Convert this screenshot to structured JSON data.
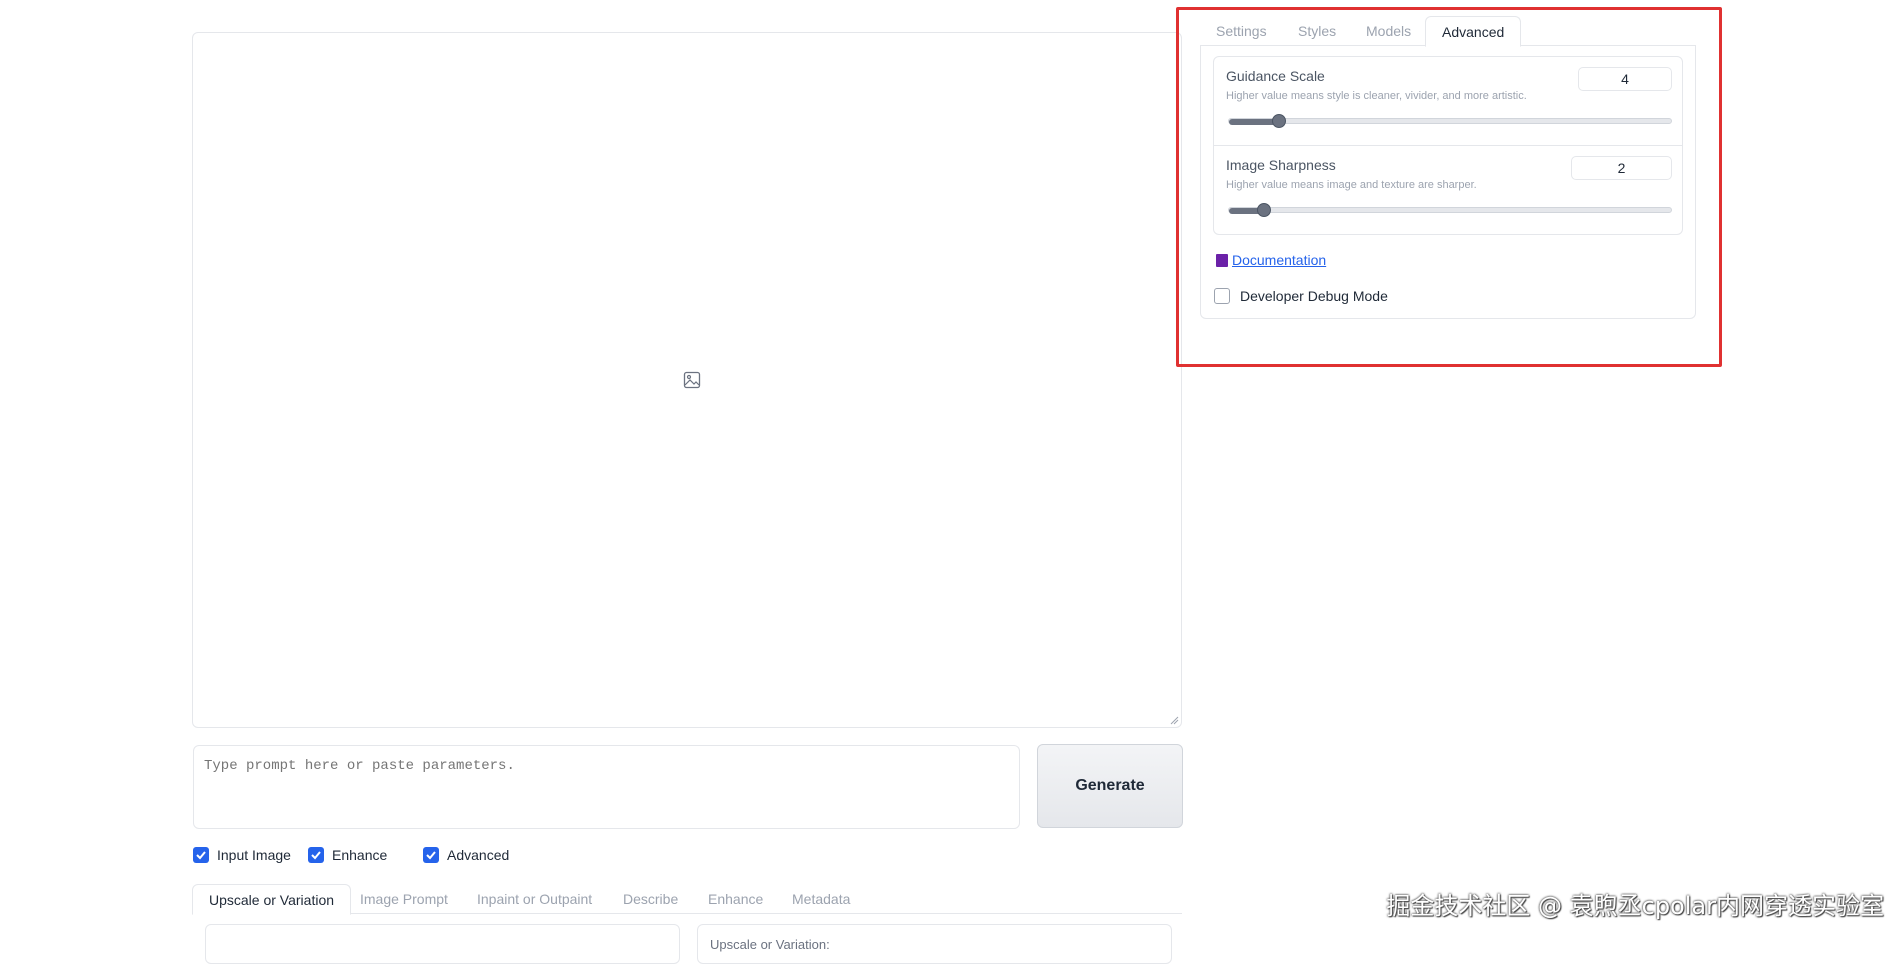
{
  "image_area": {
    "icon": "image-placeholder-icon"
  },
  "prompt": {
    "placeholder": "Type prompt here or paste parameters."
  },
  "generate": {
    "label": "Generate"
  },
  "options": [
    {
      "label": "Input Image",
      "checked": true
    },
    {
      "label": "Enhance",
      "checked": true
    },
    {
      "label": "Advanced",
      "checked": true
    }
  ],
  "bottom_tabs": [
    "Upscale or Variation",
    "Image Prompt",
    "Inpaint or Outpaint",
    "Describe",
    "Enhance",
    "Metadata"
  ],
  "bottom_active_tab": "Upscale or Variation",
  "bottom_panel_right_label": "Upscale or Variation:",
  "right_tabs": [
    "Settings",
    "Styles",
    "Models",
    "Advanced"
  ],
  "right_active_tab": "Advanced",
  "guidance": {
    "title": "Guidance Scale",
    "desc": "Higher value means style is cleaner, vivider, and more artistic.",
    "value": "4",
    "level": 0.1
  },
  "sharpness": {
    "title": "Image Sharpness",
    "desc": "Higher value means image and texture are sharper.",
    "value": "2",
    "level": 0.07
  },
  "documentation": {
    "label": "Documentation",
    "icon": "book-icon"
  },
  "debug": {
    "label": "Developer Debug Mode",
    "checked": false
  },
  "highlight_color": "#e03131",
  "accent_color": "#2563eb",
  "watermark": "掘金技术社区 @ 袁煦丞cpolar内网穿透实验室"
}
